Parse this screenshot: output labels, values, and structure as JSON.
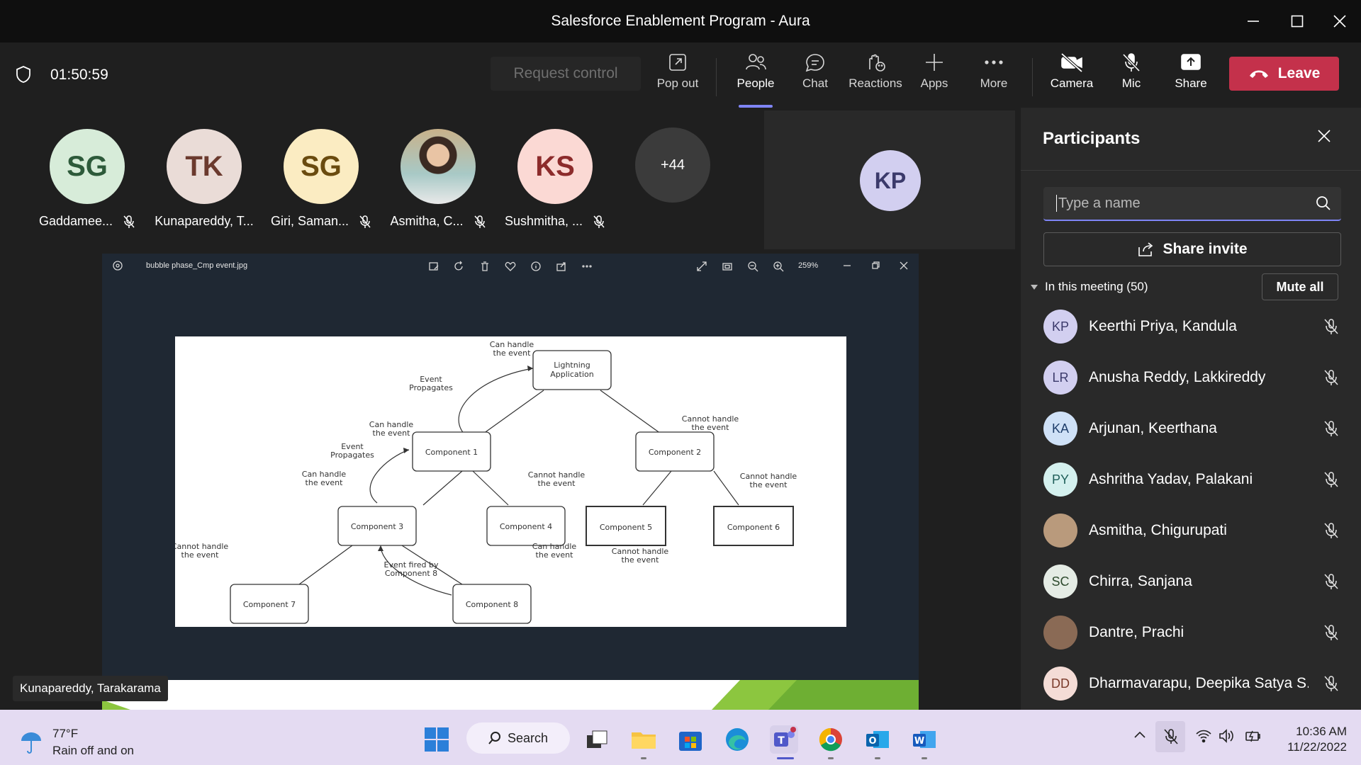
{
  "window": {
    "title": "Salesforce Enablement Program - Aura"
  },
  "toolbar": {
    "timer": "01:50:59",
    "request_control": "Request control",
    "pop_out": "Pop out",
    "people": "People",
    "chat": "Chat",
    "reactions": "Reactions",
    "apps": "Apps",
    "more": "More",
    "camera": "Camera",
    "mic": "Mic",
    "share": "Share",
    "leave": "Leave"
  },
  "gallery": {
    "tiles": [
      {
        "initials": "SG",
        "name": "Gaddamee...",
        "bg": "#d7ecd9",
        "fg": "#2d5a3a"
      },
      {
        "initials": "TK",
        "name": "Kunapareddy, T...",
        "bg": "#eadcd7",
        "fg": "#6b3a2e"
      },
      {
        "initials": "SG",
        "name": "Giri, Saman...",
        "bg": "#fbecc2",
        "fg": "#6a4b0f"
      },
      {
        "initials": "",
        "name": "Asmitha, C...",
        "bg": "#b99a7c",
        "fg": "#ffffff"
      },
      {
        "initials": "KS",
        "name": "Sushmitha, ...",
        "bg": "#fbd9d4",
        "fg": "#8c2b2b"
      }
    ],
    "overflow": "+44",
    "self_initials": "KP"
  },
  "viewer": {
    "filename": "bubble phase_Cmp event.jpg",
    "zoom": "259%",
    "presenter": "Kunapareddy, Tarakarama"
  },
  "diagram": {
    "nodes": {
      "app": [
        "Lightning",
        "Application"
      ],
      "c1": "Component 1",
      "c2": "Component 2",
      "c3": "Component 3",
      "c4": "Component 4",
      "c5": "Component 5",
      "c6": "Component 6",
      "c7": "Component 7",
      "c8": "Component 8"
    },
    "labels": {
      "can_handle": [
        "Can handle",
        "the event"
      ],
      "cannot_handle": [
        "Cannot handle",
        "the event"
      ],
      "propagates": [
        "Event",
        "Propagates"
      ],
      "fired_by": [
        "Event fired by",
        "Component 8"
      ]
    }
  },
  "panel": {
    "title": "Participants",
    "search_placeholder": "Type a name",
    "share_invite": "Share invite",
    "in_meeting": "In this meeting (50)",
    "mute_all": "Mute all",
    "participants": [
      {
        "initials": "KP",
        "name": "Keerthi Priya, Kandula",
        "bg": "#d2cff0",
        "fg": "#3b3a6b"
      },
      {
        "initials": "LR",
        "name": "Anusha Reddy, Lakkireddy",
        "bg": "#d2cff0",
        "fg": "#3b3a6b"
      },
      {
        "initials": "KA",
        "name": "Arjunan, Keerthana",
        "bg": "#cfe1f7",
        "fg": "#1f3e6b"
      },
      {
        "initials": "PY",
        "name": "Ashritha Yadav, Palakani",
        "bg": "#d4f0ee",
        "fg": "#1f5f5a"
      },
      {
        "initials": "",
        "name": "Asmitha, Chigurupati",
        "bg": "#b99a7c",
        "fg": "#ffffff"
      },
      {
        "initials": "SC",
        "name": "Chirra, Sanjana",
        "bg": "#e5ece5",
        "fg": "#2d4a2d"
      },
      {
        "initials": "",
        "name": "Dantre, Prachi",
        "bg": "#8a6a55",
        "fg": "#ffffff"
      },
      {
        "initials": "DD",
        "name": "Dharmavarapu, Deepika Satya S...",
        "bg": "#f4dcd6",
        "fg": "#7a3a2a"
      }
    ]
  },
  "taskbar": {
    "temp": "77°F",
    "weather": "Rain off and on",
    "search": "Search",
    "time": "10:36 AM",
    "date": "11/22/2022"
  },
  "colors": {
    "accent": "#7f85f5",
    "leave": "#c4314b"
  }
}
